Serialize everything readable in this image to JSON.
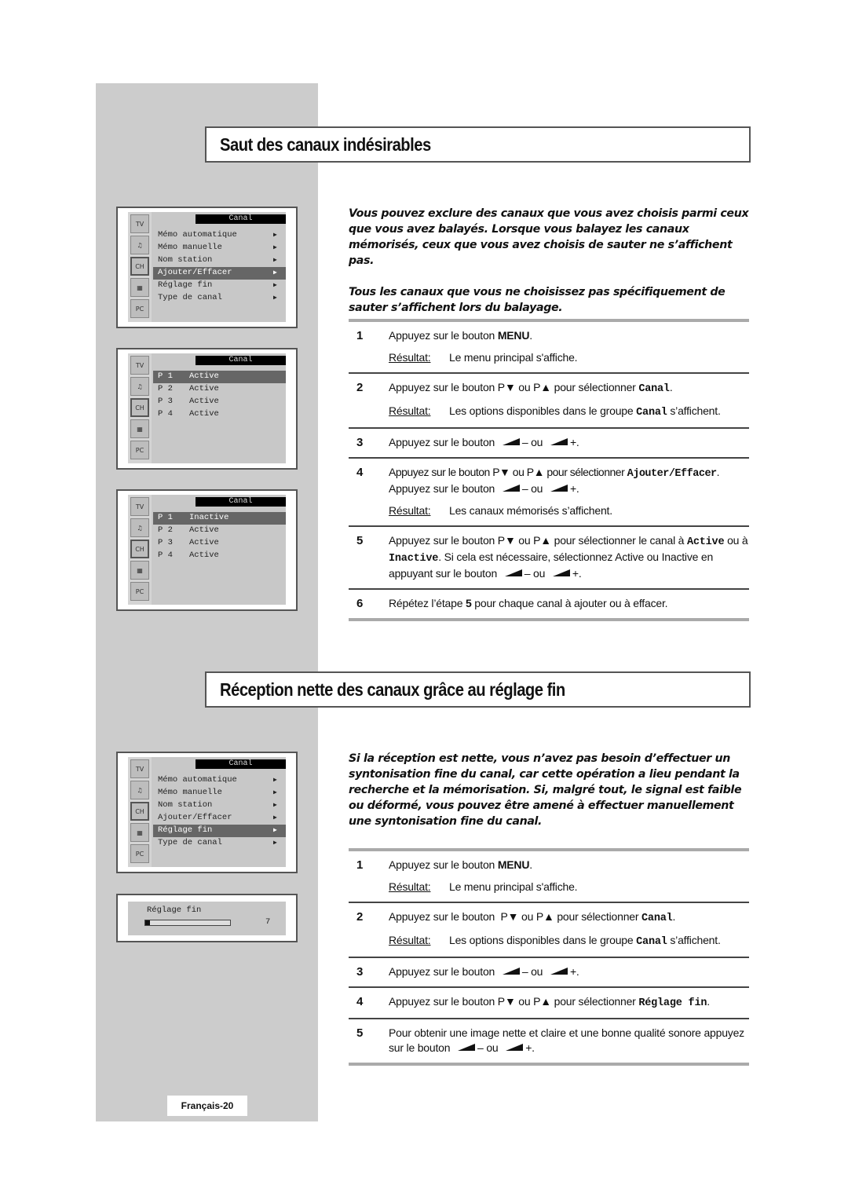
{
  "section1": {
    "title": "Saut des canaux indésirables",
    "intro": [
      "Vous pouvez exclure des canaux que vous avez choisis parmi ceux que vous avez balayés. Lorsque vous balayez les canaux mémorisés, ceux que vous avez choisis de sauter ne s’affichent pas.",
      "Tous les canaux que vous ne choisissez pas spécifiquement de sauter s’affichent lors du balayage."
    ],
    "steps": [
      {
        "num": "1",
        "pre": "Appuyez sur le bouton ",
        "bold": "MENU",
        "post": ".",
        "result_label": "Résultat:",
        "result": "Le menu principal s'affiche."
      },
      {
        "num": "2",
        "pre": "Appuyez sur le bouton P▼ ou P▲ pour sélectionner ",
        "mono": "Canal",
        "post": ".",
        "result_label": "Résultat:",
        "result_pre": "Les options disponibles dans le groupe ",
        "result_mono": "Canal",
        "result_post": " s’affichent."
      },
      {
        "num": "3",
        "pre": "Appuyez sur le bouton ",
        "minus": "– ou ",
        "plus": "+."
      },
      {
        "num": "4",
        "pre": "Appuyez sur le bouton P▼ ou P▲ pour sélectionner ",
        "mono": "Ajouter/Effacer",
        "post": ".",
        "line2_pre": "Appuyez sur le bouton ",
        "minus": "– ou ",
        "plus": "+.",
        "result_label": "Résultat:",
        "result": "Les canaux mémorisés s’affichent."
      },
      {
        "num": "5",
        "pre": "Appuyez sur le bouton P▼ ou P▲ pour sélectionner le canal à ",
        "mono1": "Active",
        "mid1": " ou à ",
        "mono2": "Inactive",
        "mid2": ". Si cela est nécessaire, sélectionnez Active ou Inactive en appuyant sur le bouton ",
        "minus": "– ou ",
        "plus": "+."
      },
      {
        "num": "6",
        "pre": "Répétez l’étape ",
        "bold": "5",
        "post": " pour chaque canal à ajouter ou à effacer."
      }
    ]
  },
  "section2": {
    "title": "Réception nette des canaux grâce au réglage fin",
    "intro": "Si la réception est nette, vous n’avez pas besoin d’effectuer un syntonisation fine du canal, car cette opération a lieu pendant la recherche et la mémorisation. Si, malgré tout, le signal est faible ou déformé, vous pouvez être amené à effectuer manuellement une syntonisation fine du canal.",
    "steps": [
      {
        "num": "1",
        "pre": "Appuyez sur le bouton ",
        "bold": "MENU",
        "post": ".",
        "result_label": "Résultat:",
        "result": "Le menu principal s'affiche."
      },
      {
        "num": "2",
        "pre": "Appuyez sur le bouton  P▼ ou P▲ pour sélectionner ",
        "mono": "Canal",
        "post": ".",
        "result_label": "Résultat:",
        "result_pre": "Les options disponibles dans le groupe ",
        "result_mono": "Canal",
        "result_post": " s’affichent."
      },
      {
        "num": "3",
        "pre": "Appuyez sur le bouton ",
        "minus": "– ou ",
        "plus": "+."
      },
      {
        "num": "4",
        "pre": "Appuyez sur le bouton P▼ ou P▲ pour sélectionner ",
        "mono": "Réglage fin",
        "post": "."
      },
      {
        "num": "5",
        "pre": "Pour obtenir une image nette et claire et une bonne qualité sonore appuyez sur le bouton ",
        "minus": "– ou ",
        "plus": "+."
      }
    ]
  },
  "osd_icons": [
    "TV",
    "♫",
    "CH",
    "▦",
    "PC"
  ],
  "osd_menu1": {
    "title": "Canal",
    "items": [
      "Mémo automatique",
      "Mémo manuelle",
      "Nom station",
      "Ajouter/Effacer",
      "Réglage fin",
      "Type de canal"
    ],
    "selected": "Ajouter/Effacer",
    "arrow": "▶"
  },
  "osd_menu2": {
    "title": "Canal",
    "rows": [
      {
        "ch": "P 1",
        "status": "Active"
      },
      {
        "ch": "P 2",
        "status": "Active"
      },
      {
        "ch": "P 3",
        "status": "Active"
      },
      {
        "ch": "P 4",
        "status": "Active"
      }
    ]
  },
  "osd_menu3": {
    "title": "Canal",
    "rows": [
      {
        "ch": "P 1",
        "status": "Inactive"
      },
      {
        "ch": "P 2",
        "status": "Active"
      },
      {
        "ch": "P 3",
        "status": "Active"
      },
      {
        "ch": "P 4",
        "status": "Active"
      }
    ]
  },
  "osd_menu4": {
    "title": "Canal",
    "items": [
      "Mémo automatique",
      "Mémo manuelle",
      "Nom station",
      "Ajouter/Effacer",
      "Réglage fin",
      "Type de canal"
    ],
    "selected": "Réglage fin",
    "arrow": "▶"
  },
  "osd_fine": {
    "title": "Réglage fin",
    "value": "7",
    "fill_fraction": 0.06
  },
  "footer": {
    "page": "Français-20"
  }
}
